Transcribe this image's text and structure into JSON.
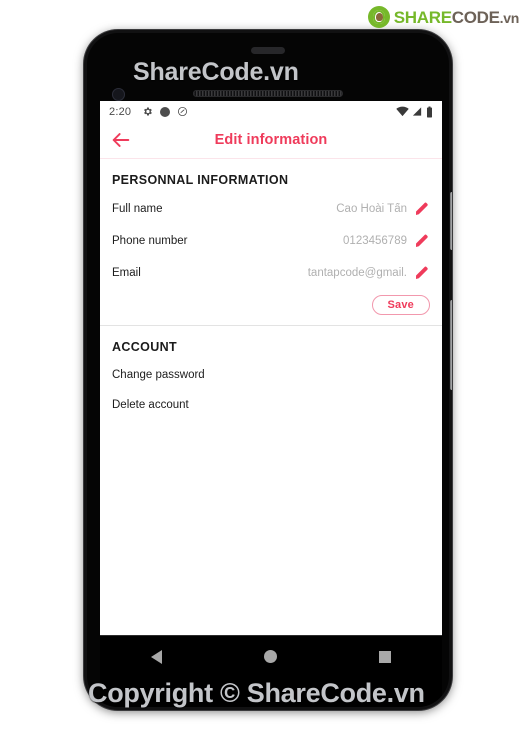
{
  "branding": {
    "logo_share": "SHARE",
    "logo_code": "CODE",
    "logo_tld": ".vn",
    "logo_icon": "sharecode-leaf-logo",
    "accent_green": "#76b82a",
    "logo_text_color": "#6d6258"
  },
  "watermarks": {
    "top": "ShareCode.vn",
    "bottom": "Copyright © ShareCode.vn"
  },
  "device": {
    "frame_color": "#111112",
    "earpiece": "earpiece-speaker",
    "front_camera": "front-camera",
    "power_button": "power-button",
    "volume_button": "volume-button"
  },
  "status_bar": {
    "clock": "2:20",
    "left_icons": [
      "gear-icon",
      "filled-circle-icon",
      "circled-slash-icon"
    ],
    "right_icons": [
      "wifi-icon",
      "signal-icon",
      "battery-icon"
    ]
  },
  "app_bar": {
    "back_icon": "back-arrow-icon",
    "title": "Edit information",
    "accent": "#ef3b5b"
  },
  "personal_section": {
    "title": "PERSONNAL INFORMATION",
    "fields": [
      {
        "label": "Full name",
        "value": "Cao Hoài Tấn",
        "edit_icon": "pencil-icon"
      },
      {
        "label": "Phone number",
        "value": "0123456789",
        "edit_icon": "pencil-icon"
      },
      {
        "label": "Email",
        "value": "tantapcode@gmail.",
        "edit_icon": "pencil-icon"
      }
    ],
    "save_label": "Save"
  },
  "account_section": {
    "title": "ACCOUNT",
    "items": [
      {
        "label": "Change password"
      },
      {
        "label": "Delete account"
      }
    ]
  },
  "nav_bar": {
    "back": "nav-back-icon",
    "home": "nav-home-icon",
    "recents": "nav-recents-icon"
  }
}
